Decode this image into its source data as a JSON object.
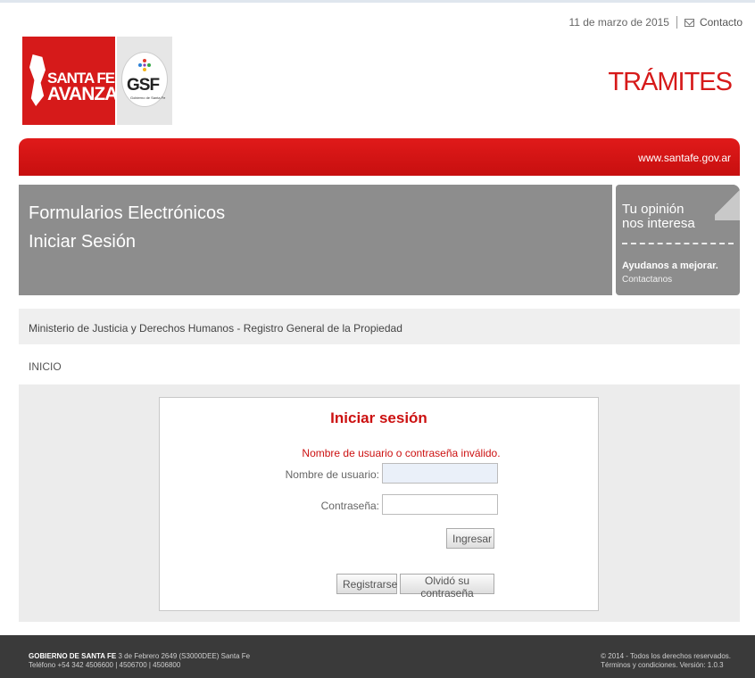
{
  "header": {
    "date": "11 de marzo de 2015",
    "contact_label": "Contacto",
    "brand_line1": "SANTA FE",
    "brand_line2": "AVANZA",
    "gsf_logo_text": "GSF",
    "gsf_subtitle": "Gobierno de Santa Fe",
    "tramites": "TRÁMITES",
    "website": "www.santafe.gov.ar"
  },
  "banner": {
    "line1": "Formularios Electrónicos",
    "line2": "Iniciar Sesión"
  },
  "opinion": {
    "line1": "Tu opinión",
    "line2": "nos interesa",
    "cta": "Ayudanos a mejorar.",
    "link": "Contactanos"
  },
  "breadcrumb": {
    "ministry": "Ministerio de Justicia y Derechos Humanos - Registro General de la Propiedad",
    "current": "INICIO"
  },
  "login": {
    "title": "Iniciar sesión",
    "error": "Nombre de usuario o contraseña inválido.",
    "username_label": "Nombre de usuario:",
    "username_value": "",
    "password_label": "Contraseña:",
    "password_value": "",
    "submit_label": "Ingresar",
    "register_label": "Registrarse",
    "forgot_label": "Olvidó su contraseña"
  },
  "footer": {
    "org": "GOBIERNO DE SANTA FE",
    "address": " 3 de Febrero 2649 (S3000DEE) Santa Fe",
    "phone": "Teléfono +54 342 4506600 | 4506700 | 4506800",
    "copyright": "© 2014 - Todos los derechos reservados.",
    "terms": "Términos y condiciones. Versión: 1.0.3"
  },
  "colors": {
    "brand_red": "#d61a1a",
    "banner_gray": "#8d8d8d",
    "footer_dark": "#3a3a3a"
  }
}
